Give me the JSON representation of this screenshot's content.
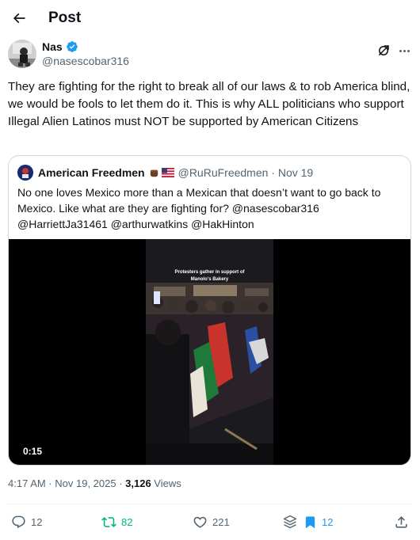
{
  "header": {
    "title": "Post"
  },
  "post": {
    "author_name": "Nas",
    "author_handle": "@nasescobar316",
    "text": "They are fighting for the right to break all of our laws & to rob America blind, we would be fools to let them do it. This is why ALL politicians who support Illegal Alien Latinos must NOT be supported by American Citizens",
    "time": "4:17 AM · Nov 19, 2025 · ",
    "views_count": "3,126",
    "views_label": " Views"
  },
  "quote": {
    "author_name": "American Freedmen",
    "handle_date": "@RuRuFreedmen · Nov 19",
    "text": "No one loves Mexico more than a Mexican that doesn’t want to go back to Mexico. Like what are they are fighting for? @nasescobar316 @HarriettJa31461 @arthurwatkins @HakHinton",
    "video_overlay_line1": "Protesters gather in support of",
    "video_overlay_line2": "Manolo's Bakery",
    "video_duration": "0:15"
  },
  "actions": {
    "replies": "12",
    "reposts": "82",
    "likes": "221",
    "bookmarks": "12"
  },
  "colors": {
    "repost_green": "#00ba7c",
    "bookmark_blue": "#1d9bf0",
    "secondary_text": "#536471",
    "verified_blue": "#1d9bf0"
  },
  "icons": [
    "back-arrow-icon",
    "verified-badge-icon",
    "grok-icon",
    "more-icon",
    "reply-icon",
    "repost-icon",
    "like-icon",
    "analytics-icon",
    "bookmark-icon",
    "share-icon"
  ]
}
